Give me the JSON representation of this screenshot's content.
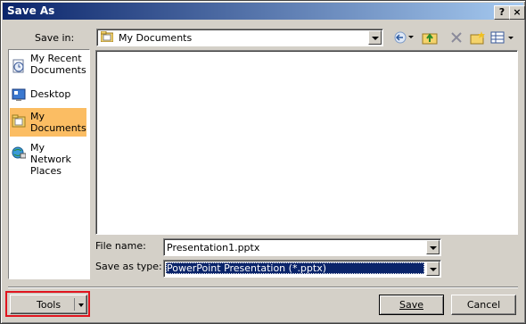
{
  "window": {
    "title": "Save As",
    "help_glyph": "?",
    "close_glyph": "×"
  },
  "toolbar": {
    "save_in_label": "Save in:",
    "save_in_value": "My Documents",
    "icons": [
      "back-icon",
      "up-folder-icon",
      "delete-icon",
      "new-folder-icon",
      "views-icon"
    ]
  },
  "sidebar": {
    "items": [
      {
        "label": "My Recent Documents",
        "icon": "recent-documents-icon"
      },
      {
        "label": "Desktop",
        "icon": "desktop-icon"
      },
      {
        "label": "My Documents",
        "icon": "my-documents-icon",
        "selected": true
      },
      {
        "label": "My Network Places",
        "icon": "network-places-icon"
      }
    ]
  },
  "form": {
    "file_name_label": "File name:",
    "file_name_value": "Presentation1.pptx",
    "save_type_label": "Save as type:",
    "save_type_value": "PowerPoint Presentation (*.pptx)"
  },
  "buttons": {
    "tools": "Tools",
    "save": "Save",
    "cancel": "Cancel"
  },
  "colors": {
    "selection": "#0a246a",
    "sidebar_selected": "#fbbd63",
    "highlight_border": "#e0141e"
  }
}
